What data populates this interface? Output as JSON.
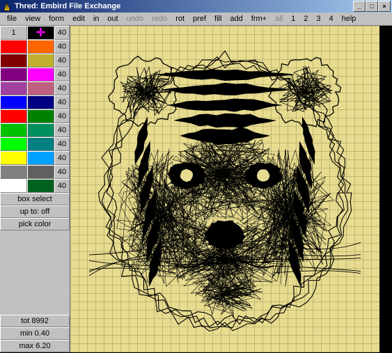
{
  "window": {
    "title": "Thred: Embird File Exchange"
  },
  "winbuttons": {
    "min": "_",
    "max": "□",
    "close": "×"
  },
  "menu": {
    "items": [
      "file",
      "view",
      "form",
      "edit",
      "in",
      "out",
      "undo",
      "redo",
      "rot",
      "pref",
      "fill",
      "add",
      "frm+",
      "all",
      "1",
      "2",
      "3",
      "4",
      "help"
    ],
    "disabled": [
      "undo",
      "redo",
      "all"
    ]
  },
  "palette": {
    "current_index": "1",
    "rows": [
      {
        "colors": [
          "#000000",
          "#000000"
        ],
        "val": "40",
        "sel": 1
      },
      {
        "colors": [
          "#ff0000",
          "#ff6600"
        ],
        "val": "40"
      },
      {
        "colors": [
          "#800000",
          "#c0b030"
        ],
        "val": "40"
      },
      {
        "colors": [
          "#800080",
          "#ff00ff"
        ],
        "val": "40"
      },
      {
        "colors": [
          "#a040a0",
          "#c06080"
        ],
        "val": "40"
      },
      {
        "colors": [
          "#0000ff",
          "#000080"
        ],
        "val": "40"
      },
      {
        "colors": [
          "#ff0000",
          "#008000"
        ],
        "val": "40"
      },
      {
        "colors": [
          "#00c000",
          "#009060"
        ],
        "val": "40"
      },
      {
        "colors": [
          "#00ff00",
          "#008080"
        ],
        "val": "40"
      },
      {
        "colors": [
          "#ffff00",
          "#00a0ff"
        ],
        "val": "40"
      },
      {
        "colors": [
          "#808080",
          "#606060"
        ],
        "val": "40"
      },
      {
        "colors": [
          "#ffffff",
          "#006020"
        ],
        "val": "40"
      }
    ]
  },
  "buttons": {
    "box_select": "box select",
    "up_to": "up to: off",
    "pick_color": "pick color"
  },
  "stats": {
    "tot": "tot 8992",
    "min": "min 0.40",
    "max": "max 6.20"
  },
  "canvas": {
    "artwork_description": "tiger-face-stitch-pattern"
  }
}
